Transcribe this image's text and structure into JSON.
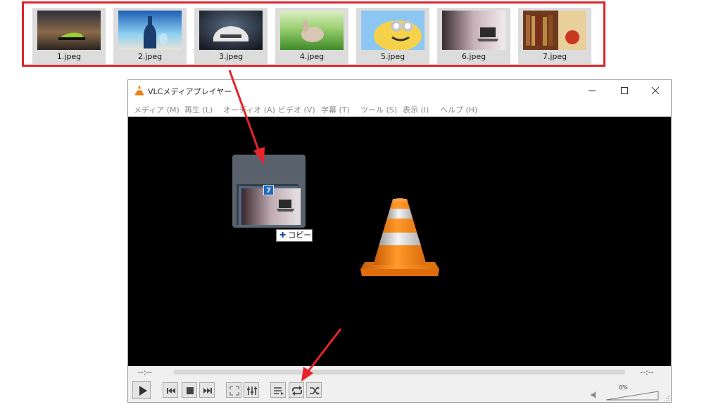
{
  "thumbnails": [
    {
      "label": "1.jpeg",
      "colors": [
        "#3a2f2e",
        "#7a5a3a",
        "#222"
      ],
      "accent": "#9acd32"
    },
    {
      "label": "2.jpeg",
      "colors": [
        "#1c5fb4",
        "#7fc2ee",
        "#e6e4dc"
      ],
      "accent": "#1a3d6e"
    },
    {
      "label": "3.jpeg",
      "colors": [
        "#1b2230",
        "#4c5c70",
        "#20242c"
      ],
      "accent": "#e8e8e8"
    },
    {
      "label": "4.jpeg",
      "colors": [
        "#8cc66a",
        "#bde08a",
        "#3f8a2a"
      ],
      "accent": "#d9c9b8"
    },
    {
      "label": "5.jpeg",
      "colors": [
        "#7cbcf0",
        "#cfe6fb",
        "#6aa5dd"
      ],
      "accent": "#f5d24a"
    },
    {
      "label": "6.jpeg",
      "colors": [
        "#3a2a30",
        "#c7b2b8",
        "#efe8ea"
      ],
      "accent": "#2c2c2c"
    },
    {
      "label": "7.jpeg",
      "colors": [
        "#6e3a1e",
        "#a5673a",
        "#e9cf9a"
      ],
      "accent": "#c8371f"
    }
  ],
  "window": {
    "title": "VLCメディアプレイヤー",
    "minimize_icon": "minimize-icon",
    "maximize_icon": "maximize-icon",
    "close_icon": "close-icon"
  },
  "menu": [
    "メディア (M)",
    "再生 (L)",
    "オーディオ (A)",
    "ビデオ (V)",
    "字幕 (T)",
    "ツール (S)",
    "表示 (I)",
    "ヘルプ (H)"
  ],
  "drag": {
    "count_badge": "7",
    "copy_label": "コピー",
    "copy_icon": "plus-icon"
  },
  "player": {
    "elapsed": "--:--",
    "remaining": "--:--",
    "volume_label": "0%",
    "volume_level": 0,
    "progress": 0
  },
  "controls": [
    {
      "name": "play-button",
      "icon": "play-icon"
    },
    {
      "name": "previous-button",
      "icon": "skip-back-icon"
    },
    {
      "name": "stop-button",
      "icon": "stop-icon"
    },
    {
      "name": "next-button",
      "icon": "skip-forward-icon"
    },
    {
      "name": "fullscreen-button",
      "icon": "fullscreen-icon"
    },
    {
      "name": "extended-settings-button",
      "icon": "equalizer-icon"
    },
    {
      "name": "playlist-button",
      "icon": "playlist-icon"
    },
    {
      "name": "loop-button",
      "icon": "loop-icon"
    },
    {
      "name": "shuffle-button",
      "icon": "shuffle-icon"
    }
  ],
  "colors": {
    "highlight_box": "#d9232d",
    "arrow": "#e8232a",
    "video_bg": "#000000",
    "cone_orange": "#f07c12"
  }
}
